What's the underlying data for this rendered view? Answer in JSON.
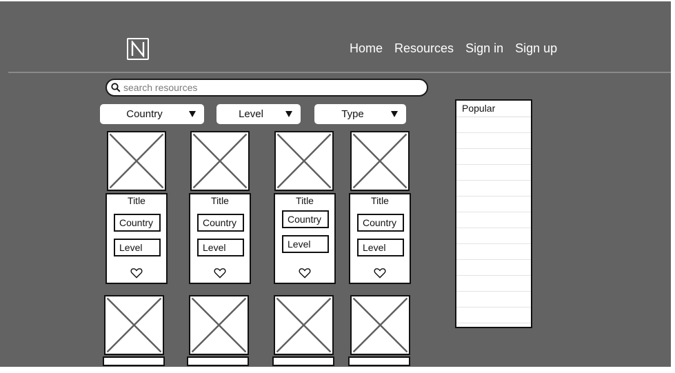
{
  "header": {
    "logo_letter": "N",
    "nav": [
      "Home",
      "Resources",
      "Sign in",
      "Sign up"
    ]
  },
  "search": {
    "placeholder": "search resources",
    "value": ""
  },
  "filters": [
    "Country",
    "Level",
    "Type"
  ],
  "cards": [
    {
      "title": "Title",
      "country": "Country",
      "level": "Level"
    },
    {
      "title": "Title",
      "country": "Country",
      "level": "Level"
    },
    {
      "title": "Title",
      "country": "Country",
      "level": "Level"
    },
    {
      "title": "Title",
      "country": "Country",
      "level": "Level"
    }
  ],
  "popular": {
    "title": "Popular",
    "rows": 13
  },
  "colors": {
    "background": "#636363",
    "surface": "#ffffff",
    "stroke": "#111111"
  }
}
